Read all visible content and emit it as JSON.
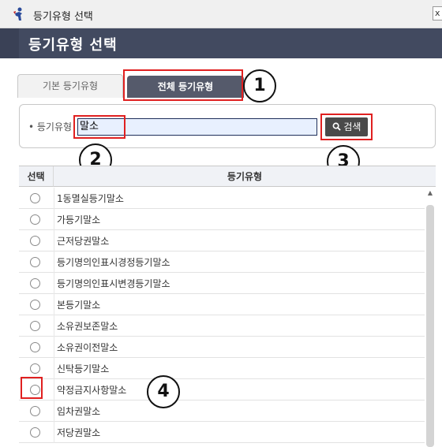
{
  "window": {
    "title": "등기유형 선택",
    "icon": "app-figure-icon",
    "close_glyph": "x"
  },
  "header": {
    "title": "등기유형 선택"
  },
  "tabs": [
    {
      "label": "기본 등기유형",
      "active": false
    },
    {
      "label": "전체 등기유형",
      "active": true
    }
  ],
  "search": {
    "label": "• 등기유형",
    "value": "말소",
    "button_label": "검색",
    "button_icon": "search-icon"
  },
  "table": {
    "columns": [
      "선택",
      "등기유형"
    ],
    "rows": [
      "1동멸실등기말소",
      "가등기말소",
      "근저당권말소",
      "등기명의인표시경정등기말소",
      "등기명의인표시변경등기말소",
      "본등기말소",
      "소유권보존말소",
      "소유권이전말소",
      "신탁등기말소",
      "약정금지사항말소",
      "임차권말소",
      "저당권말소"
    ]
  },
  "callouts": [
    "1",
    "2",
    "3",
    "4"
  ],
  "colors": {
    "header_bg": "#424a60",
    "active_tab_bg": "#555a6b",
    "highlight": "#e02020",
    "search_button_bg": "#4a4a4a"
  }
}
